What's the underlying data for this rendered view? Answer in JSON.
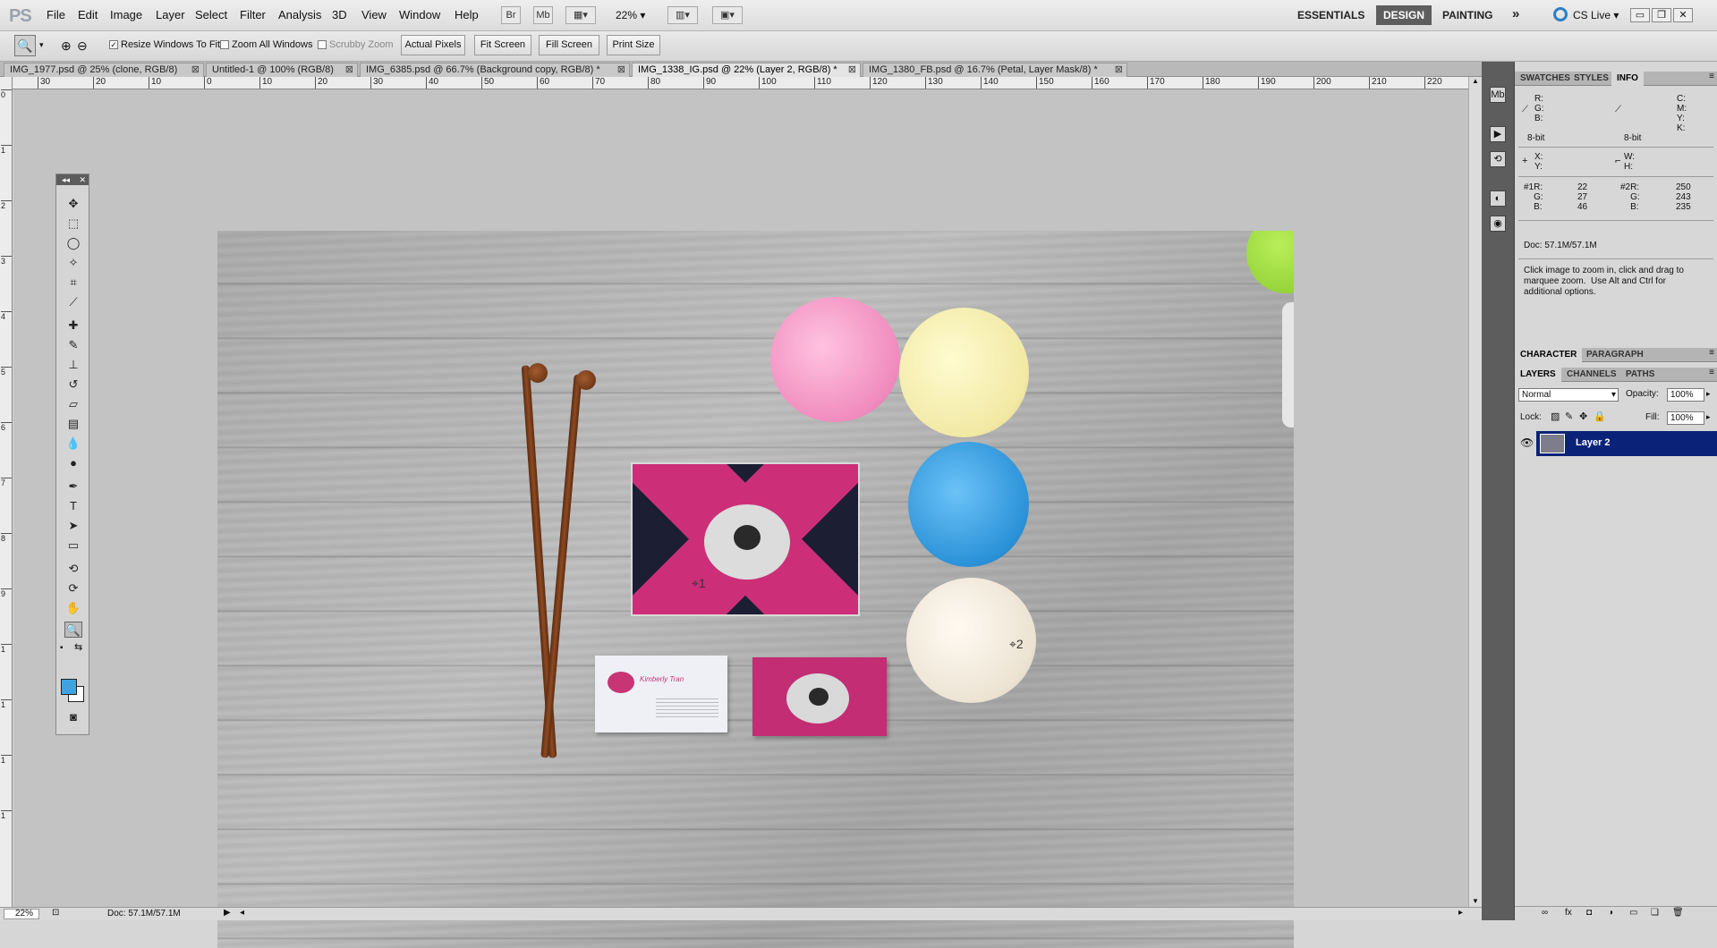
{
  "app": {
    "logo": "PS"
  },
  "menu": [
    "File",
    "Edit",
    "Image",
    "Layer",
    "Select",
    "Filter",
    "Analysis",
    "3D",
    "View",
    "Window",
    "Help"
  ],
  "appbar": {
    "bridge": "Br",
    "minibridge": "Mb",
    "zoom": "22%"
  },
  "workspaces": {
    "essentials": "ESSENTIALS",
    "design": "DESIGN",
    "painting": "PAINTING",
    "more": "»",
    "cslive": "CS Live"
  },
  "options": {
    "resize_windows": "Resize Windows To Fit",
    "zoom_all": "Zoom All Windows",
    "scrubby": "Scrubby Zoom",
    "actual_pixels": "Actual Pixels",
    "fit_screen": "Fit Screen",
    "fill_screen": "Fill Screen",
    "print_size": "Print Size"
  },
  "tabs": [
    {
      "label": "IMG_1977.psd @ 25% (clone, RGB/8)"
    },
    {
      "label": "Untitled-1 @ 100% (RGB/8)"
    },
    {
      "label": "IMG_6385.psd @ 66.7% (Background copy, RGB/8) *"
    },
    {
      "label": "IMG_1338_IG.psd @ 22% (Layer 2, RGB/8) *"
    },
    {
      "label": "IMG_1380_FB.psd @ 16.7% (Petal, Layer Mask/8) *"
    }
  ],
  "ruler_top": [
    "30",
    "20",
    "10",
    "0",
    "10",
    "20",
    "30",
    "40",
    "50",
    "60",
    "70",
    "80",
    "90",
    "100",
    "110",
    "120",
    "130",
    "140",
    "150",
    "160",
    "170",
    "180",
    "190",
    "200",
    "210",
    "220"
  ],
  "ruler_left": [
    "0",
    "1",
    "2",
    "3",
    "4",
    "5",
    "6",
    "7",
    "8",
    "9",
    "1",
    "1",
    "1",
    "1"
  ],
  "card_text": "Kimberly Tran",
  "cursors": {
    "one": "⌖1",
    "two": "⌖2"
  },
  "status": {
    "zoom": "22%",
    "doc": "Doc: 57.1M/57.1M"
  },
  "panels": {
    "top_tabs": [
      "SWATCHES",
      "STYLES",
      "INFO"
    ],
    "info": {
      "rgb_labels": "R:\nG:\nB:",
      "cmyk_labels": "C:\nM:\nY:\nK:",
      "bit_left": "8-bit",
      "bit_right": "8-bit",
      "xy": "X:\nY:",
      "wh": "W:\nH:",
      "sample1_labels": "#1R:\n    G:\n    B:",
      "sample1_values": "22\n27\n46",
      "sample2_labels": "#2R:\n    G:\n    B:",
      "sample2_values": "250\n243\n235",
      "doc": "Doc: 57.1M/57.1M",
      "hint": "Click image to zoom in, click and drag to\nmarquee zoom.  Use Alt and Ctrl for\nadditional options."
    },
    "char_tabs": [
      "CHARACTER",
      "PARAGRAPH"
    ],
    "layer_tabs": [
      "LAYERS",
      "CHANNELS",
      "PATHS"
    ],
    "layers": {
      "blend_mode": "Normal",
      "opacity_label": "Opacity:",
      "opacity": "100%",
      "lock_label": "Lock:",
      "fill_label": "Fill:",
      "fill": "100%",
      "layer_name": "Layer 2"
    }
  },
  "colors": {
    "foreground": "#3fa3e0",
    "background": "#ffffff",
    "layer_selected": "#0b2279"
  }
}
